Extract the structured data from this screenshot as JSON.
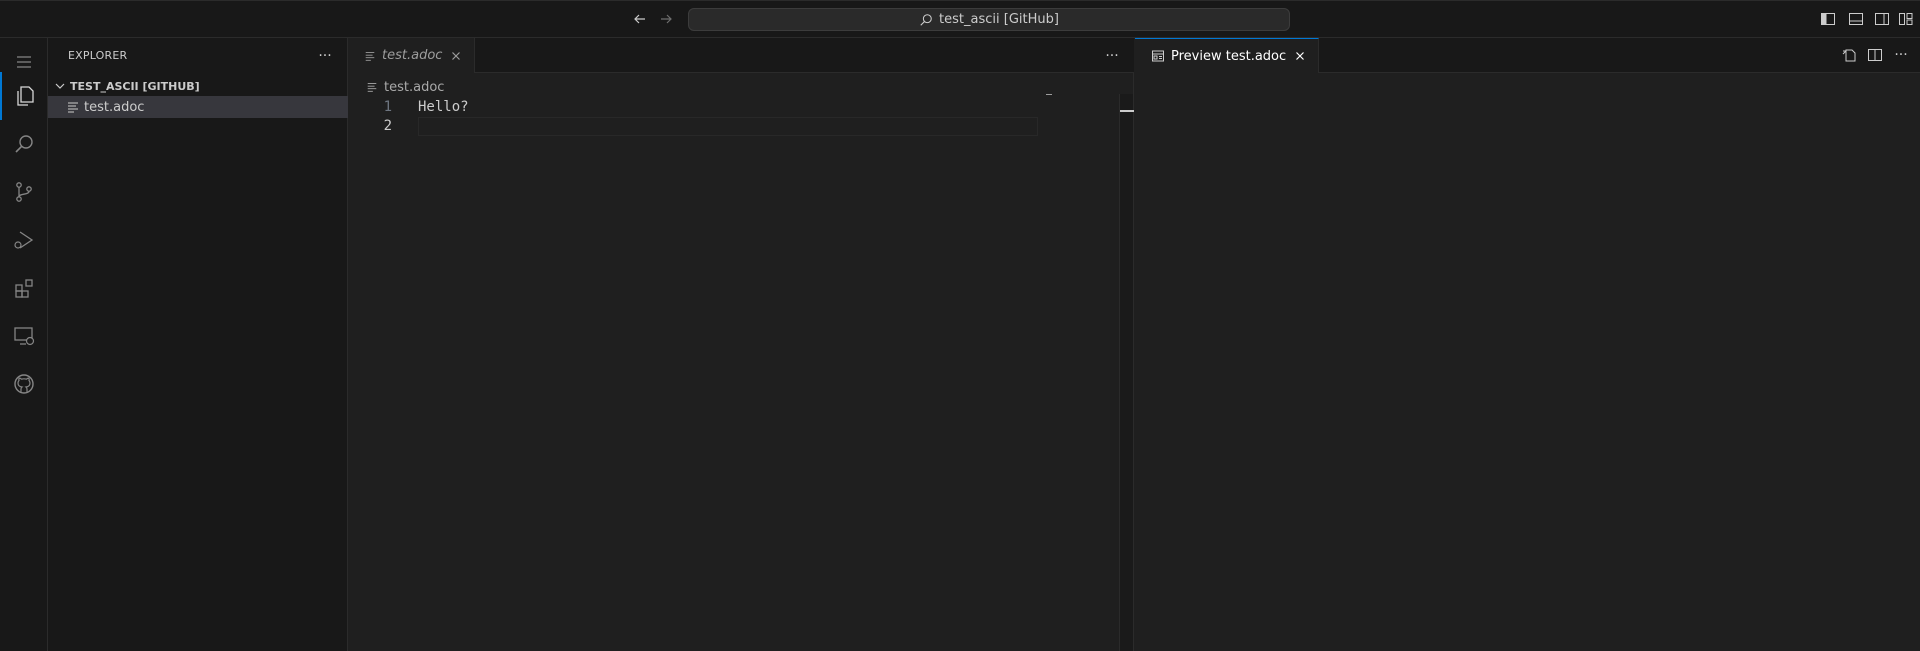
{
  "titlebar": {
    "search_text": "test_ascii [GitHub]"
  },
  "activity_bar": {
    "items": [
      "explorer",
      "search",
      "source-control",
      "run-and-debug",
      "extensions",
      "remote-explorer",
      "github"
    ]
  },
  "sidebar": {
    "title": "EXPLORER",
    "more": "···",
    "folder_name": "TEST_ASCII [GITHUB]",
    "files": [
      {
        "name": "test.adoc"
      }
    ]
  },
  "editor_left": {
    "tab_label": "test.adoc",
    "more": "···",
    "breadcrumb": "test.adoc",
    "lines": [
      {
        "number": "1",
        "text": "Hello?"
      },
      {
        "number": "2",
        "text": ""
      }
    ]
  },
  "editor_right": {
    "tab_label": "Preview test.adoc",
    "more": "···"
  },
  "colors": {
    "accent": "#0078d4",
    "background": "#1f1f1f",
    "chrome": "#181818"
  }
}
